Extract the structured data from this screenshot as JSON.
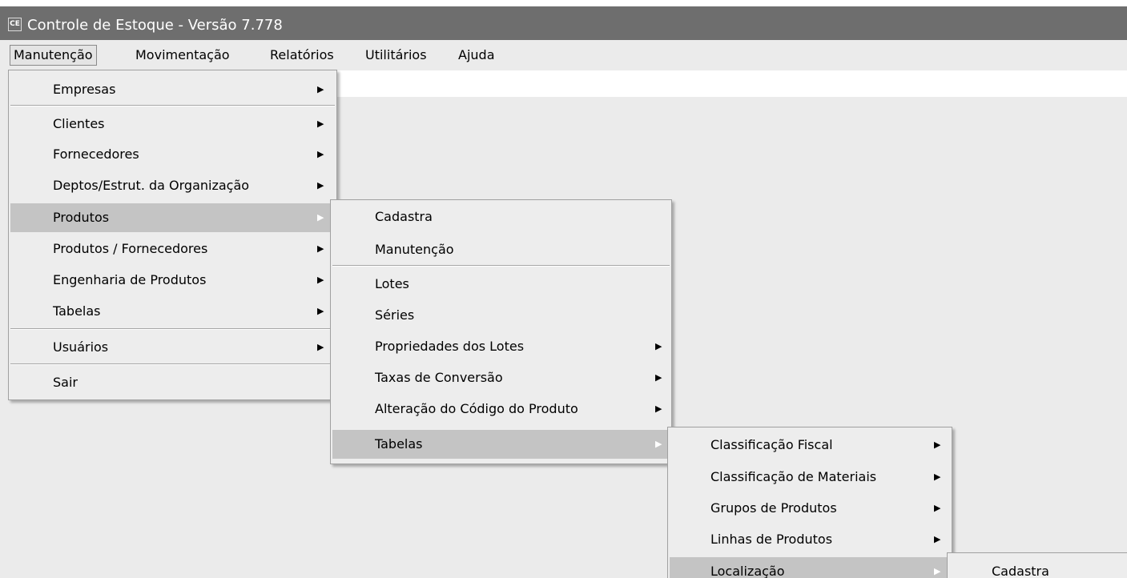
{
  "window": {
    "icon_text": "CE",
    "title": "Controle de Estoque - Versão 7.778"
  },
  "menubar": {
    "items": [
      {
        "label": "Manutenção"
      },
      {
        "label": "Movimentação"
      },
      {
        "label": "Relatórios"
      },
      {
        "label": "Utilitários"
      },
      {
        "label": "Ajuda"
      }
    ]
  },
  "menu_manutencao": {
    "items": [
      {
        "label": "Empresas",
        "arrow": "▶"
      },
      {
        "label": "Clientes",
        "arrow": "▶"
      },
      {
        "label": "Fornecedores",
        "arrow": "▶"
      },
      {
        "label": "Deptos/Estrut. da Organização",
        "arrow": "▶"
      },
      {
        "label": "Produtos",
        "arrow": "▶"
      },
      {
        "label": "Produtos / Fornecedores",
        "arrow": "▶"
      },
      {
        "label": "Engenharia de Produtos",
        "arrow": "▶"
      },
      {
        "label": "Tabelas",
        "arrow": "▶"
      },
      {
        "label": "Usuários",
        "arrow": "▶"
      },
      {
        "label": "Sair"
      }
    ]
  },
  "menu_produtos": {
    "items": [
      {
        "label": "Cadastra"
      },
      {
        "label": "Manutenção"
      },
      {
        "label": "Lotes"
      },
      {
        "label": "Séries"
      },
      {
        "label": "Propriedades dos Lotes",
        "arrow": "▶"
      },
      {
        "label": "Taxas de Conversão",
        "arrow": "▶"
      },
      {
        "label": "Alteração do Código do Produto",
        "arrow": "▶"
      },
      {
        "label": "Tabelas",
        "arrow": "▶"
      }
    ]
  },
  "menu_tabelas": {
    "items": [
      {
        "label": "Classificação Fiscal",
        "arrow": "▶"
      },
      {
        "label": "Classificação de Materiais",
        "arrow": "▶"
      },
      {
        "label": "Grupos de Produtos",
        "arrow": "▶"
      },
      {
        "label": "Linhas de Produtos",
        "arrow": "▶"
      },
      {
        "label": "Localização",
        "arrow": "▶"
      }
    ]
  },
  "menu_localizacao": {
    "items": [
      {
        "label": "Cadastra"
      }
    ]
  }
}
